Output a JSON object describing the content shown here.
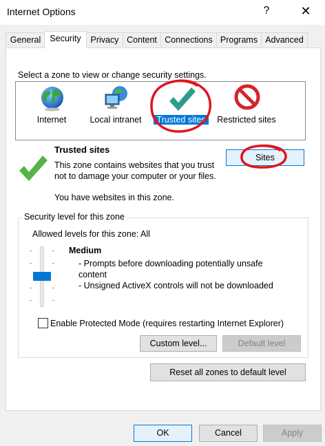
{
  "window": {
    "title": "Internet Options",
    "help_glyph": "?",
    "close_glyph": "✕"
  },
  "tabs": [
    "General",
    "Security",
    "Privacy",
    "Content",
    "Connections",
    "Programs",
    "Advanced"
  ],
  "zones": {
    "instruction": "Select a zone to view or change security settings.",
    "items": [
      {
        "label": "Internet",
        "icon": "globe-icon"
      },
      {
        "label": "Local intranet",
        "icon": "intranet-icon"
      },
      {
        "label": "Trusted sites",
        "icon": "checkmark-icon",
        "selected": true
      },
      {
        "label": "Restricted sites",
        "icon": "restricted-icon"
      }
    ]
  },
  "zone_info": {
    "title": "Trusted sites",
    "description": "This zone contains websites that you trust not to damage your computer or your files.",
    "status": "You have websites in this zone.",
    "sites_button": "Sites"
  },
  "security_level": {
    "group_title": "Security level for this zone",
    "allowed": "Allowed levels for this zone: All",
    "level_name": "Medium",
    "bullet_1": "- Prompts before downloading potentially unsafe content",
    "bullet_2": "- Unsigned ActiveX controls will not be downloaded",
    "protected_mode": "Enable Protected Mode (requires restarting Internet Explorer)",
    "protected_mode_checked": false,
    "custom_level": "Custom level...",
    "default_level": "Default level"
  },
  "reset_all": "Reset all zones to default level",
  "footer": {
    "ok": "OK",
    "cancel": "Cancel",
    "apply": "Apply"
  },
  "colors": {
    "accent": "#0078d7",
    "annotation": "#e0141e",
    "check_green": "#56b346",
    "restricted_red": "#d6232a"
  }
}
